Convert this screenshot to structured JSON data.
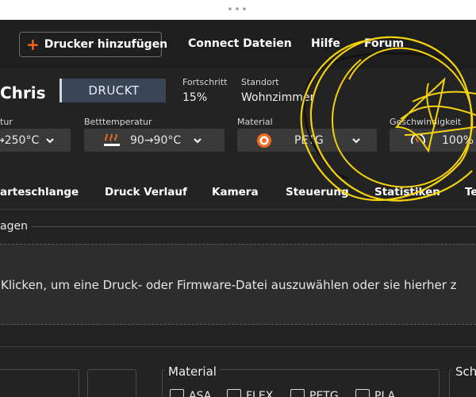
{
  "window": {
    "drag_handle": "•••"
  },
  "header": {
    "add_printer_label": "Drucker hinzufügen",
    "add_printer_icon": "+",
    "nav": [
      "Connect Dateien",
      "Hilfe",
      "Forum"
    ]
  },
  "printer": {
    "name": "Chris",
    "status": "DRUCKT",
    "progress_label": "Fortschritt",
    "progress_value": "15%",
    "location_label": "Standort",
    "location_value": "Wohnzimmer"
  },
  "controls": {
    "nozzle": {
      "label": "tur",
      "value": "→250°C"
    },
    "bed": {
      "label": "Betttemperatur",
      "value": "90→90°C",
      "icon": "heatbed-icon"
    },
    "material": {
      "label": "Material",
      "value": "PETG",
      "icon": "spool-icon"
    },
    "speed": {
      "label": "Geschwindigkeit",
      "value": "100%",
      "icon": "gauge-icon"
    }
  },
  "tabs": [
    "arteschlange",
    "Druck Verlauf",
    "Kamera",
    "Steuerung",
    "Statistiken",
    "Te"
  ],
  "upload": {
    "section_title": "agen",
    "dropzone_text": "Klicken, um eine Druck- oder Firmware-Datei auszuwählen oder sie hierher z"
  },
  "filters": {
    "material_title": "Material",
    "materials": [
      "ASA",
      "FLEX",
      "PETG",
      "PLA"
    ],
    "right_title": "Sch"
  },
  "colors": {
    "accent": "#f26b21",
    "status_bg": "#3a4656",
    "app_bg": "#232323",
    "scribble": "#f5d20e"
  }
}
